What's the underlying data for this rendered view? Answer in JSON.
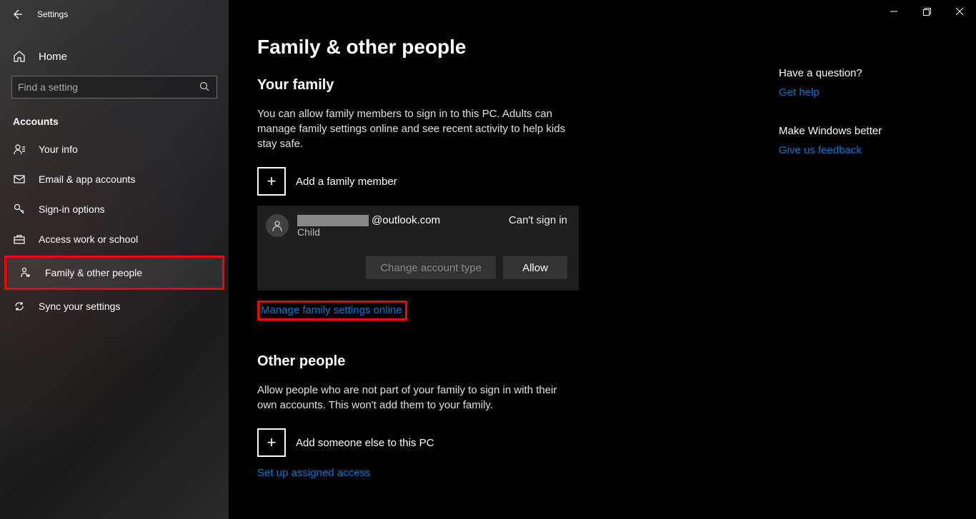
{
  "titlebar": {
    "app_name": "Settings"
  },
  "sidebar": {
    "home_label": "Home",
    "search_placeholder": "Find a setting",
    "category": "Accounts",
    "items": [
      {
        "icon": "person-icon",
        "label": "Your info"
      },
      {
        "icon": "mail-icon",
        "label": "Email & app accounts"
      },
      {
        "icon": "key-icon",
        "label": "Sign-in options"
      },
      {
        "icon": "briefcase-icon",
        "label": "Access work or school"
      },
      {
        "icon": "family-icon",
        "label": "Family & other people"
      },
      {
        "icon": "sync-icon",
        "label": "Sync your settings"
      }
    ]
  },
  "main": {
    "page_title": "Family & other people",
    "family": {
      "heading": "Your family",
      "desc": "You can allow family members to sign in to this PC. Adults can manage family settings online and see recent activity to help kids stay safe.",
      "add_label": "Add a family member",
      "member": {
        "email_suffix": "@outlook.com",
        "role": "Child",
        "status": "Can't sign in",
        "change_btn": "Change account type",
        "allow_btn": "Allow"
      },
      "manage_link": "Manage family settings online"
    },
    "other": {
      "heading": "Other people",
      "desc": "Allow people who are not part of your family to sign in with their own accounts. This won't add them to your family.",
      "add_label": "Add someone else to this PC",
      "setup_link": "Set up assigned access"
    }
  },
  "right": {
    "question_heading": "Have a question?",
    "help_link": "Get help",
    "better_heading": "Make Windows better",
    "feedback_link": "Give us feedback"
  }
}
